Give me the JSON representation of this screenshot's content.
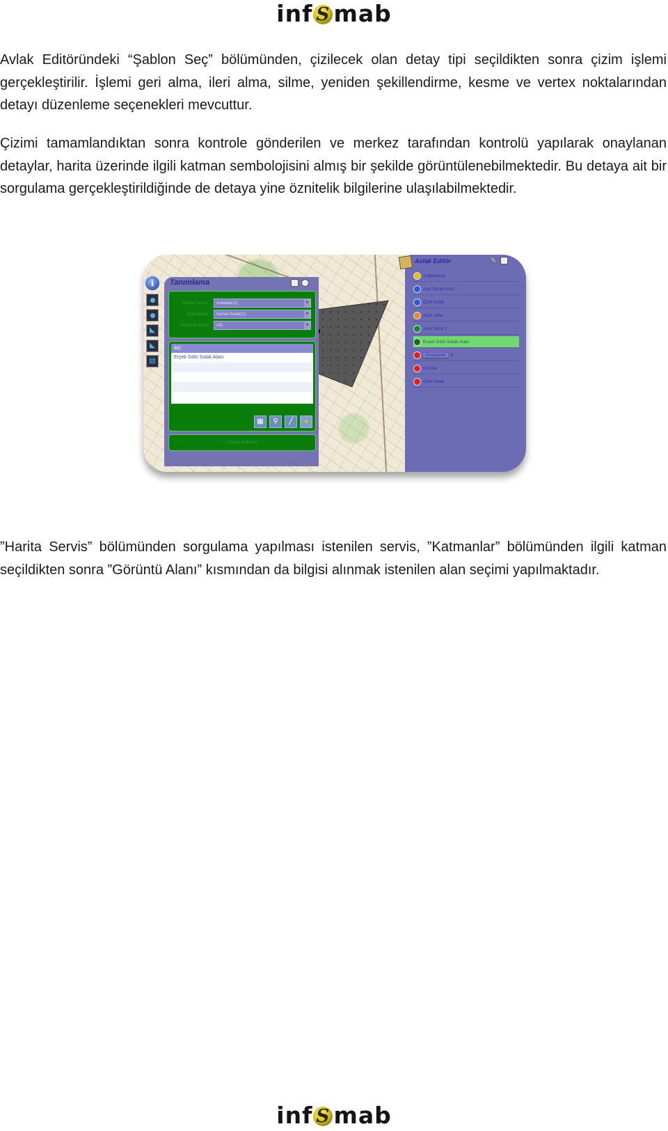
{
  "header": {
    "logo_left": "inf",
    "logo_right": "mab"
  },
  "footer": {
    "logo_left": "inf",
    "logo_right": "mab"
  },
  "paragraphs": [
    "Avlak Editöründeki “Şablon Seç” bölümünden, çizilecek olan detay tipi seçildikten sonra çizim işlemi gerçekleştirilir. İşlemi geri alma, ileri alma, silme, yeniden şekillendirme, kesme ve vertex noktalarından detayı düzenleme seçenekleri mevcuttur.",
    "Çizimi tamamlandıktan sonra kontrole gönderilen ve merkez tarafından kontrolü yapılarak onaylanan detaylar, harita üzerinde ilgili katman sembolojisini almış bir şekilde görüntülenebilmektedir. Bu detaya ait bir sorgulama gerçekleştirildiğinde de detaya yine öznitelik bilgilerine ulaşılabilmektedir.",
    "”Harita Servis” bölümünden sorgulama yapılması istenilen servis, ”Katmanlar” bölümünden ilgili katman seçildikten sonra ”Görüntü Alanı” kısmından da bilgisi alınmak istenilen alan seçimi yapılmaktadır."
  ],
  "screenshot": {
    "left_toolbar": {
      "info_label": "i",
      "tools": [
        "point-tool",
        "point-tool-2",
        "polygon-tool",
        "polygon-tool-2",
        "delete-tool"
      ]
    },
    "tanimlama_panel": {
      "title": "Tanımlama",
      "fields": [
        {
          "label": "Harita Servis:",
          "value": "Avlaklar(1)"
        },
        {
          "label": "Katmanlar:",
          "value": "Genel Avlak(1)"
        },
        {
          "label": "Görüntü Alanı:",
          "value": "AD"
        }
      ],
      "list_header": "AD",
      "list_items": [
        "Erçek Gölü Sulak Alanı",
        "",
        "",
        ""
      ],
      "tools": [
        "save-icon",
        "zoom-icon",
        "pencil-icon",
        "broom-icon"
      ],
      "result_text": "1 Kayıt bulundu"
    },
    "avlak_editor": {
      "title": "Avlak Editör",
      "items": [
        {
          "label": "Soğanlıçay",
          "color": "#e8c000",
          "selected": false
        },
        {
          "label": "Ava Yasak Alan",
          "color": "#2a5ad8",
          "selected": false
        },
        {
          "label": "Özel Avlak",
          "color": "#2a5ad8",
          "selected": false
        },
        {
          "label": "Açık saha",
          "color": "#f08a20",
          "selected": false
        },
        {
          "label": "Açık Saha 1",
          "color": "#1a8a1a",
          "selected": false
        },
        {
          "label": "Erçek Gölü Sulak Alanı",
          "color": "#1a6a1a",
          "selected": true
        },
        {
          "label": "Onaylandı",
          "suffix": "9",
          "color": "#e02020",
          "selected": false
        },
        {
          "label": "Kızılca",
          "color": "#e02020",
          "selected": false
        },
        {
          "label": "Özel Avlak",
          "color": "#e02020",
          "selected": false
        }
      ]
    },
    "colors": {
      "panel_purple": "#7474b4",
      "panel_green": "#0a7d0a",
      "selected_green": "#72d872",
      "polygon_fill": "#555555"
    }
  }
}
